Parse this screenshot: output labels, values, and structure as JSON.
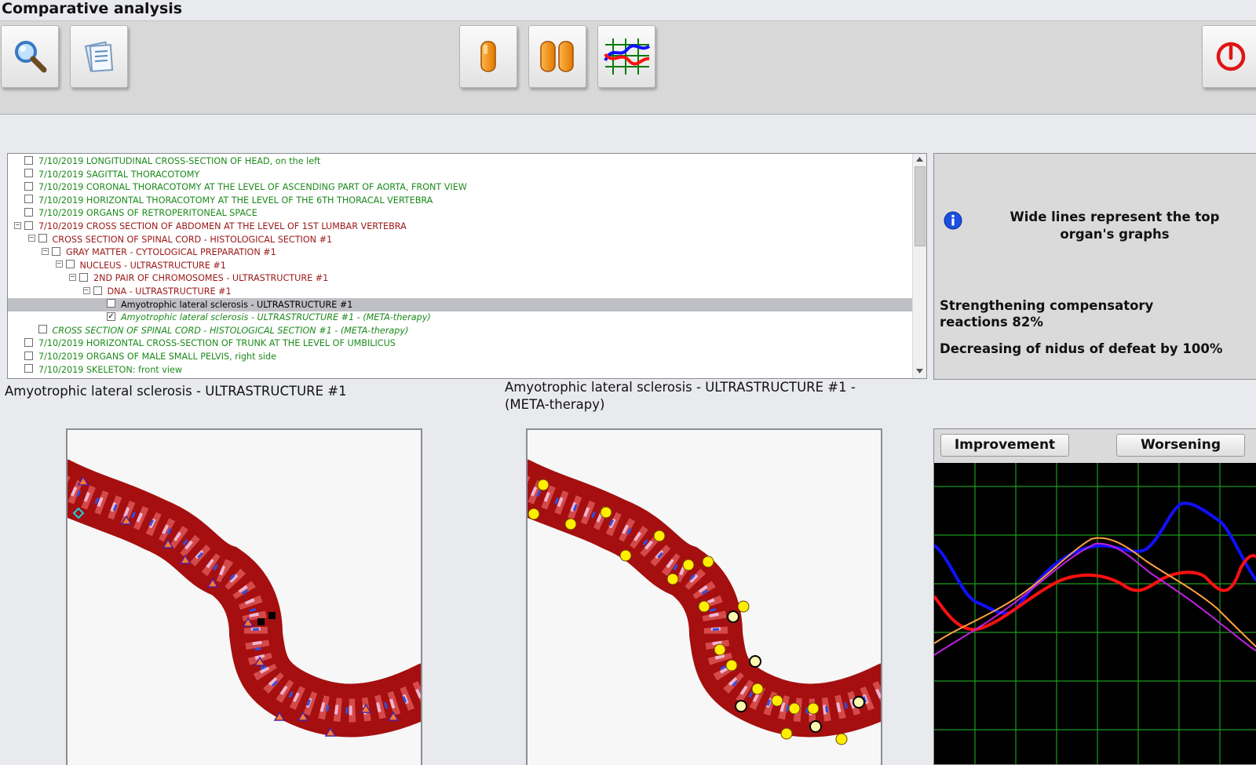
{
  "window": {
    "title": "Comparative analysis"
  },
  "toolbar": {
    "buttons": [
      {
        "name": "search-button",
        "icon": "magnifier-icon"
      },
      {
        "name": "clipboard-button",
        "icon": "clipboard-icon"
      },
      {
        "name": "single-view-button",
        "icon": "single-capsule-icon"
      },
      {
        "name": "dual-view-button",
        "icon": "double-capsule-icon"
      },
      {
        "name": "graph-view-button",
        "icon": "graph-icon"
      },
      {
        "name": "power-button",
        "icon": "power-icon"
      }
    ]
  },
  "tree": {
    "rows": [
      {
        "text": "7/10/2019  LONGITUDINAL CROSS-SECTION OF HEAD, on the left",
        "color": "green",
        "level": 0,
        "expander": "",
        "checked": false,
        "italic": false,
        "selected": false
      },
      {
        "text": "7/10/2019  SAGITTAL THORACOTOMY",
        "color": "green",
        "level": 0,
        "expander": "",
        "checked": false,
        "italic": false,
        "selected": false
      },
      {
        "text": "7/10/2019  CORONAL THORACOTOMY AT THE LEVEL OF ASCENDING PART OF AORTA, FRONT VIEW",
        "color": "green",
        "level": 0,
        "expander": "",
        "checked": false,
        "italic": false,
        "selected": false
      },
      {
        "text": "7/10/2019  HORIZONTAL THORACOTOMY AT THE LEVEL OF THE 6TH THORACAL VERTEBRA",
        "color": "green",
        "level": 0,
        "expander": "",
        "checked": false,
        "italic": false,
        "selected": false
      },
      {
        "text": "7/10/2019  ORGANS OF RETROPERITONEAL SPACE",
        "color": "green",
        "level": 0,
        "expander": "",
        "checked": false,
        "italic": false,
        "selected": false
      },
      {
        "text": "7/10/2019  CROSS SECTION OF ABDOMEN AT THE LEVEL OF 1ST LUMBAR VERTEBRA",
        "color": "red",
        "level": 0,
        "expander": "−",
        "checked": false,
        "italic": false,
        "selected": false
      },
      {
        "text": "CROSS  SECTION  OF  SPINAL  CORD - HISTOLOGICAL SECTION #1",
        "color": "red",
        "level": 1,
        "expander": "−",
        "checked": false,
        "italic": false,
        "selected": false
      },
      {
        "text": "GRAY MATTER - CYTOLOGICAL PREPARATION #1",
        "color": "red",
        "level": 2,
        "expander": "−",
        "checked": false,
        "italic": false,
        "selected": false
      },
      {
        "text": "NUCLEUS - ULTRASTRUCTURE #1",
        "color": "red",
        "level": 3,
        "expander": "−",
        "checked": false,
        "italic": false,
        "selected": false
      },
      {
        "text": "2ND PAIR OF CHROMOSOMES - ULTRASTRUCTURE #1",
        "color": "red",
        "level": 4,
        "expander": "−",
        "checked": false,
        "italic": false,
        "selected": false
      },
      {
        "text": "DNA - ULTRASTRUCTURE #1",
        "color": "red",
        "level": 5,
        "expander": "−",
        "checked": false,
        "italic": false,
        "selected": false
      },
      {
        "text": "Amyotrophic lateral sclerosis - ULTRASTRUCTURE #1",
        "color": "black",
        "level": 6,
        "expander": "",
        "checked": false,
        "italic": false,
        "selected": true
      },
      {
        "text": "Amyotrophic lateral sclerosis - ULTRASTRUCTURE #1 - (META-therapy)",
        "color": "green",
        "level": 6,
        "expander": "",
        "checked": true,
        "italic": true,
        "selected": false
      },
      {
        "text": "CROSS  SECTION  OF  SPINAL  CORD - HISTOLOGICAL SECTION #1 - (META-therapy)",
        "color": "green",
        "level": 1,
        "expander": "",
        "checked": false,
        "italic": true,
        "selected": false
      },
      {
        "text": "7/10/2019  HORIZONTAL CROSS-SECTION OF TRUNK AT THE LEVEL OF UMBILICUS",
        "color": "green",
        "level": 0,
        "expander": "",
        "checked": false,
        "italic": false,
        "selected": false
      },
      {
        "text": "7/10/2019  ORGANS OF MALE SMALL PELVIS, right side",
        "color": "green",
        "level": 0,
        "expander": "",
        "checked": false,
        "italic": false,
        "selected": false
      },
      {
        "text": "7/10/2019  SKELETON: front view",
        "color": "green",
        "level": 0,
        "expander": "",
        "checked": false,
        "italic": false,
        "selected": false
      }
    ]
  },
  "info": {
    "icon": "info-icon",
    "note": "Wide lines represent the top organ's graphs",
    "metric1": "Strengthening compensatory reactions 82%",
    "metric2": "Decreasing of nidus of defeat by 100%"
  },
  "captions": {
    "left": "Amyotrophic lateral sclerosis - ULTRASTRUCTURE #1",
    "right": "Amyotrophic lateral sclerosis - ULTRASTRUCTURE #1 - (META-therapy)"
  },
  "chart": {
    "improvement_label": "Improvement",
    "worsening_label": "Worsening",
    "colors": {
      "background": "#000000",
      "grid": "#1f9a1f",
      "blue": "#1010ff",
      "red": "#ff1010",
      "orange": "#ffa040",
      "purple": "#c020e0"
    }
  }
}
